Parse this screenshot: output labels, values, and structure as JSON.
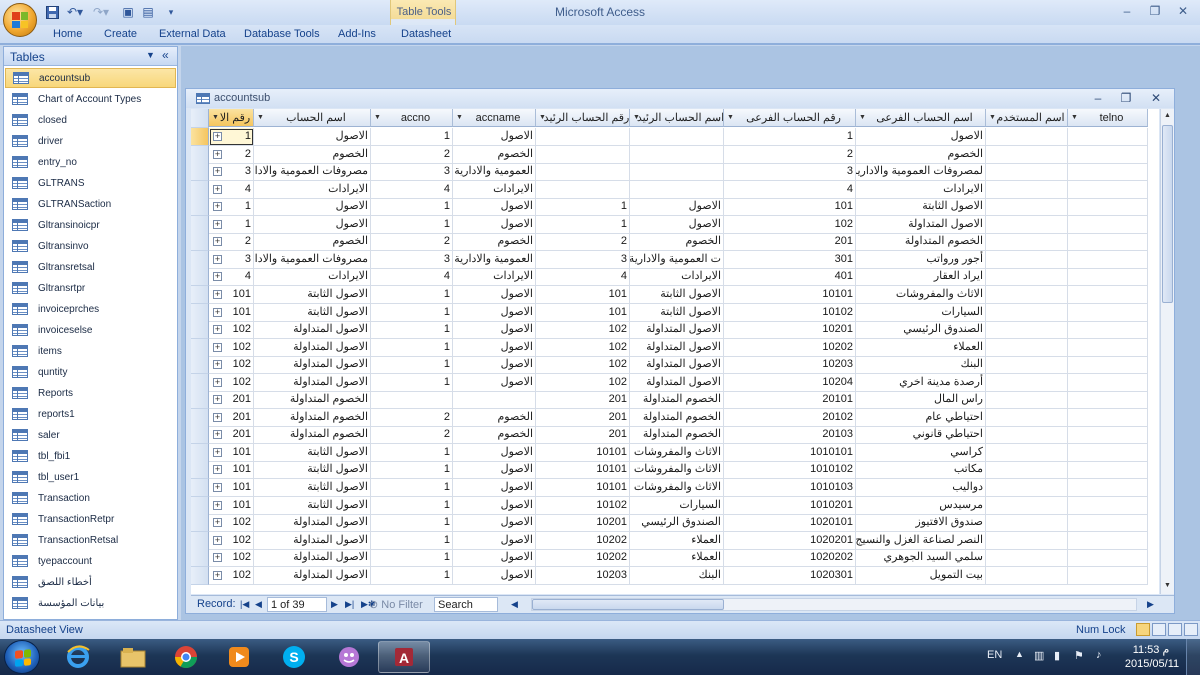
{
  "app": {
    "title": "Microsoft Access",
    "context_tab_group": "Table Tools"
  },
  "ribbon": {
    "tabs": [
      "Home",
      "Create",
      "External Data",
      "Database Tools",
      "Add-Ins",
      "Datasheet"
    ]
  },
  "nav": {
    "title": "Tables",
    "items": [
      "accountsub",
      "Chart of Account Types",
      "closed",
      "driver",
      "entry_no",
      "GLTRANS",
      "GLTRANSaction",
      "Gltransinoicpr",
      "Gltransinvo",
      "Gltransretsal",
      "Gltransrtpr",
      "invoiceprches",
      "invoiceselse",
      "items",
      "quntity",
      "Reports",
      "reports1",
      "saler",
      "tbl_fbi1",
      "tbl_user1",
      "Transaction",
      "TransactionRetpr",
      "TransactionRetsal",
      "tyepaccount",
      "أخطاء اللصق",
      "بيانات المؤسسة"
    ],
    "selected_index": 0
  },
  "table_window": {
    "title": "accountsub"
  },
  "grid": {
    "columns": [
      "رقم الا",
      "اسم الحساب",
      "accno",
      "accname",
      "رقم الحساب الرئيد",
      "اسم الحساب الرئيد",
      "رقم الحساب الفرعى",
      "اسم الحساب الفرعى",
      "اسم المستخدم",
      "telno"
    ],
    "rows": [
      [
        "1",
        "الاصول",
        "1",
        "الاصول",
        "",
        "",
        "1",
        "الاصول",
        "",
        ""
      ],
      [
        "2",
        "الخصوم",
        "2",
        "الخصوم",
        "",
        "",
        "2",
        "الخصوم",
        "",
        ""
      ],
      [
        "3",
        "مصروفات العمومية والادارية",
        "3",
        "العمومية والادارية",
        "",
        "",
        "3",
        "لمصروفات العمومية والادارية",
        "",
        ""
      ],
      [
        "4",
        "الايرادات",
        "4",
        "الايرادات",
        "",
        "",
        "4",
        "الايرادات",
        "",
        ""
      ],
      [
        "1",
        "الاصول",
        "1",
        "الاصول",
        "1",
        "الاصول",
        "101",
        "الاصول الثابتة",
        "",
        ""
      ],
      [
        "1",
        "الاصول",
        "1",
        "الاصول",
        "1",
        "الاصول",
        "102",
        "الاصول المتداولة",
        "",
        ""
      ],
      [
        "2",
        "الخصوم",
        "2",
        "الخصوم",
        "2",
        "الخصوم",
        "201",
        "الخصوم المتداولة",
        "",
        ""
      ],
      [
        "3",
        "مصروفات العمومية والادارية",
        "3",
        "العمومية والادارية",
        "3",
        "ت العمومية والادارية",
        "301",
        "أجور ورواتب",
        "",
        ""
      ],
      [
        "4",
        "الايرادات",
        "4",
        "الايرادات",
        "4",
        "الايرادات",
        "401",
        "ايراد العقار",
        "",
        ""
      ],
      [
        "101",
        "الاصول الثابتة",
        "1",
        "الاصول",
        "101",
        "الاصول الثابتة",
        "10101",
        "الاثاث والمفروشات",
        "",
        ""
      ],
      [
        "101",
        "الاصول الثابتة",
        "1",
        "الاصول",
        "101",
        "الاصول الثابتة",
        "10102",
        "السيارات",
        "",
        ""
      ],
      [
        "102",
        "الاصول المتداولة",
        "1",
        "الاصول",
        "102",
        "الاصول المتداولة",
        "10201",
        "الصندوق الرئيسي",
        "",
        ""
      ],
      [
        "102",
        "الاصول المتداولة",
        "1",
        "الاصول",
        "102",
        "الاصول المتداولة",
        "10202",
        "العملاء",
        "",
        ""
      ],
      [
        "102",
        "الاصول المتداولة",
        "1",
        "الاصول",
        "102",
        "الاصول المتداولة",
        "10203",
        "البنك",
        "",
        ""
      ],
      [
        "102",
        "الاصول المتداولة",
        "1",
        "الاصول",
        "102",
        "الاصول المتداولة",
        "10204",
        "أرصدة مدينة اخري",
        "",
        ""
      ],
      [
        "201",
        "الخصوم المتداولة",
        "",
        "",
        "201",
        "الخصوم المتداولة",
        "20101",
        "راس المال",
        "",
        ""
      ],
      [
        "201",
        "الخصوم المتداولة",
        "2",
        "الخصوم",
        "201",
        "الخصوم المتداولة",
        "20102",
        "احتياطي عام",
        "",
        ""
      ],
      [
        "201",
        "الخصوم المتداولة",
        "2",
        "الخصوم",
        "201",
        "الخصوم المتداولة",
        "20103",
        "احتياطي قانوني",
        "",
        ""
      ],
      [
        "101",
        "الاصول الثابتة",
        "1",
        "الاصول",
        "10101",
        "الاثاث والمفروشات",
        "1010101",
        "كراسي",
        "",
        ""
      ],
      [
        "101",
        "الاصول الثابتة",
        "1",
        "الاصول",
        "10101",
        "الاثاث والمفروشات",
        "1010102",
        "مكاتب",
        "",
        ""
      ],
      [
        "101",
        "الاصول الثابتة",
        "1",
        "الاصول",
        "10101",
        "الاثاث والمفروشات",
        "1010103",
        "دواليب",
        "",
        ""
      ],
      [
        "101",
        "الاصول الثابتة",
        "1",
        "الاصول",
        "10102",
        "السيارات",
        "1010201",
        "مرسيدس",
        "",
        ""
      ],
      [
        "102",
        "الاصول المتداولة",
        "1",
        "الاصول",
        "10201",
        "الصندوق الرئيسي",
        "1020101",
        "صندوق الافتيوز",
        "",
        ""
      ],
      [
        "102",
        "الاصول المتداولة",
        "1",
        "الاصول",
        "10202",
        "العملاء",
        "1020201",
        "النصر لصناعة الغزل والنسيج",
        "",
        ""
      ],
      [
        "102",
        "الاصول المتداولة",
        "1",
        "الاصول",
        "10202",
        "العملاء",
        "1020202",
        "سلمي السيد الجوهري",
        "",
        ""
      ],
      [
        "102",
        "الاصول المتداولة",
        "1",
        "الاصول",
        "10203",
        "البنك",
        "1020301",
        "بيت التمويل",
        "",
        ""
      ]
    ]
  },
  "record_nav": {
    "label": "Record:",
    "position": "1 of 39",
    "filter": "No Filter",
    "search": "Search"
  },
  "status": {
    "left": "Datasheet View",
    "numlock": "Num Lock"
  },
  "taskbar": {
    "lang": "EN",
    "time": "11:53 م",
    "date": "2015/05/11"
  },
  "colors": {
    "ribbon_text": "#15428b",
    "selection": "#f8d77a",
    "taskbar": "#1d3656"
  }
}
